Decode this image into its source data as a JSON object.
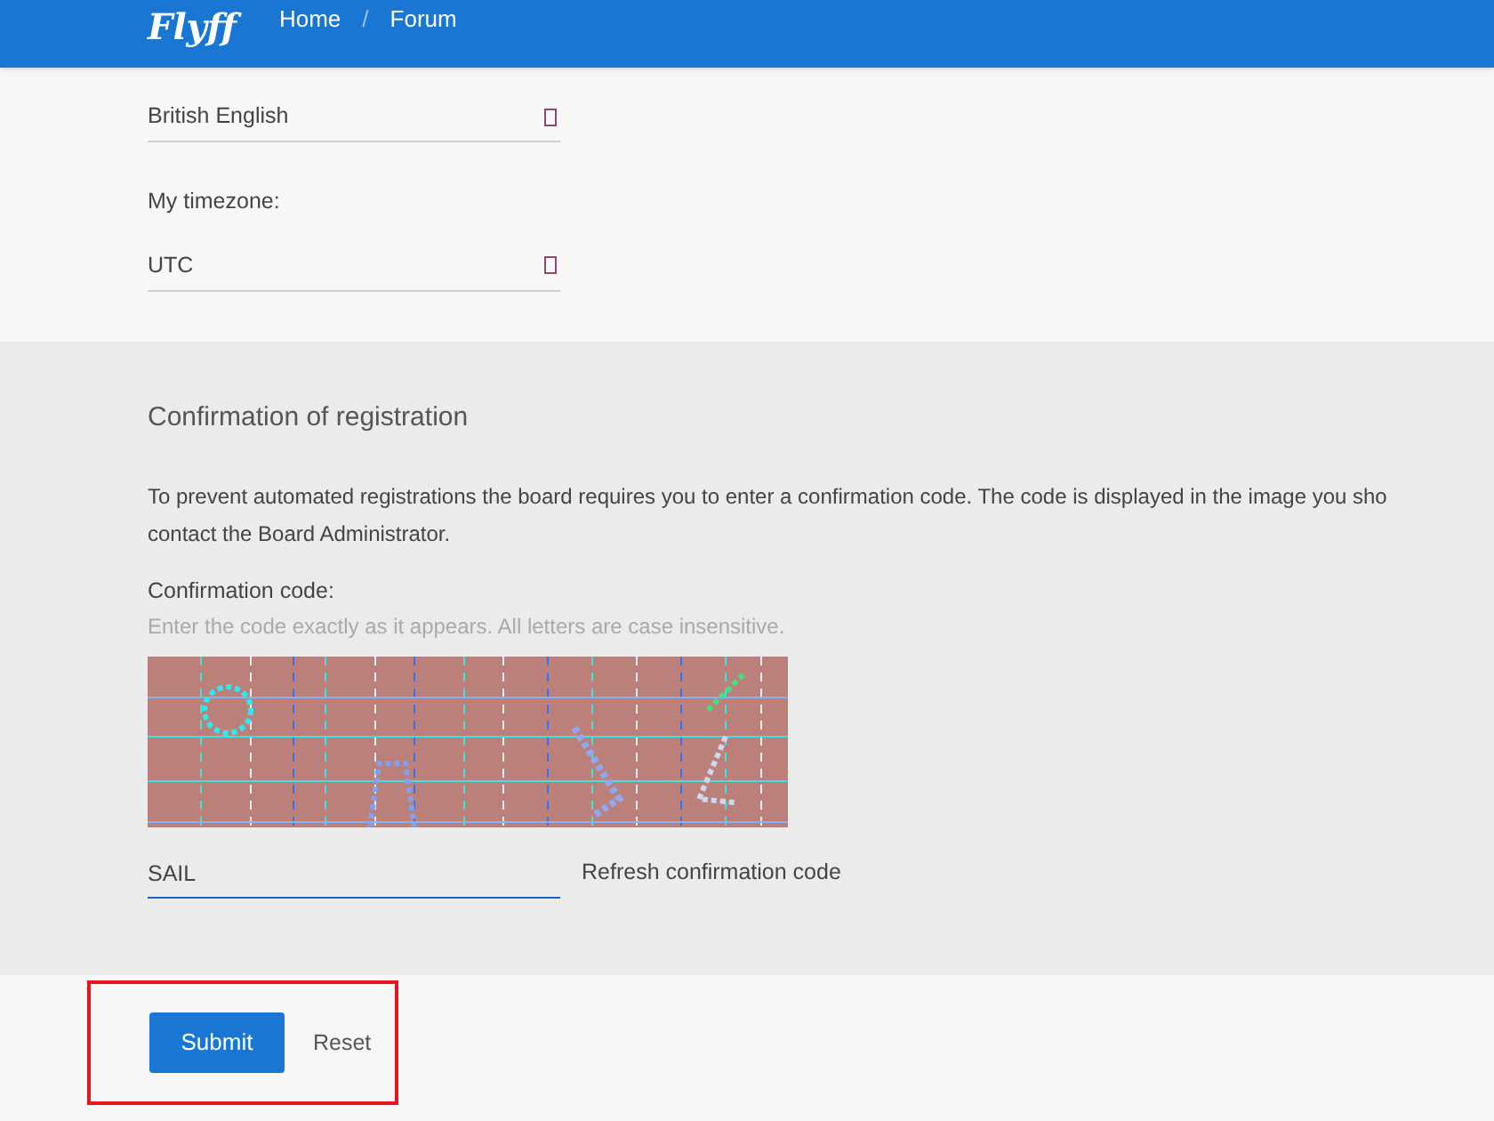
{
  "header": {
    "logo": "Flyff",
    "nav": [
      {
        "label": "Home"
      },
      {
        "label": "Forum"
      }
    ],
    "separator": "/"
  },
  "preferences": [
    {
      "value": "British English"
    },
    {
      "label": "My timezone:",
      "value": "UTC"
    }
  ],
  "confirmation": {
    "title": "Confirmation of registration",
    "paragraph": [
      "To prevent automated registrations the board requires you to enter a confirmation code. The code is displayed in the image you sho",
      "contact the Board Administrator."
    ],
    "field_label": "Confirmation code:",
    "hint": "Enter the code exactly as it appears. All letters are case insensitive.",
    "value": "SAIL",
    "refresh": "Refresh confirmation code"
  },
  "actions": {
    "submit": "Submit",
    "reset": "Reset",
    "highlighted": true
  }
}
